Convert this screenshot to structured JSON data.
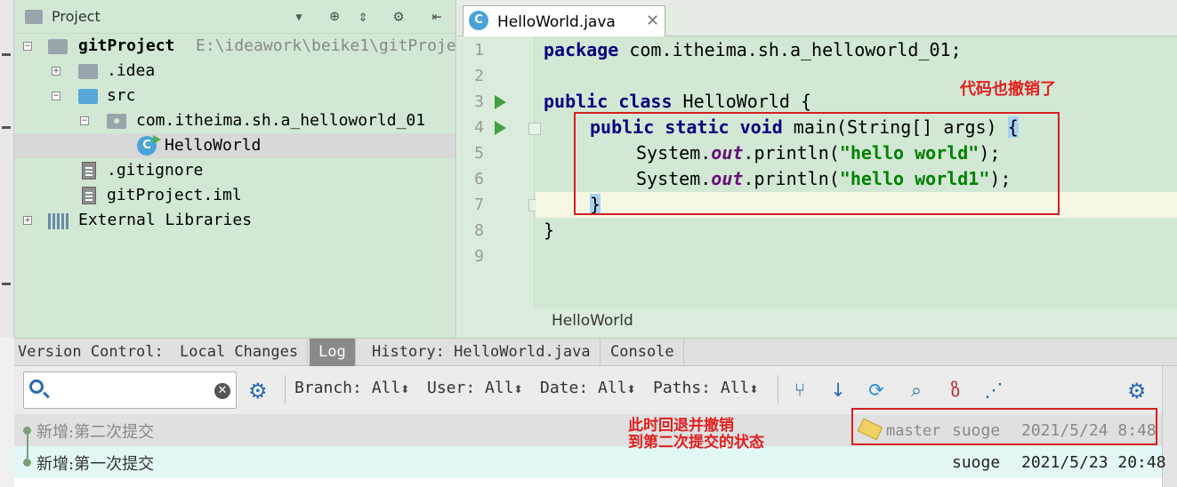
{
  "project_panel": {
    "title": "Project",
    "tree": [
      {
        "label": "gitProject",
        "path": "E:\\ideawork\\beike1\\gitProje"
      },
      {
        "label": ".idea"
      },
      {
        "label": "src"
      },
      {
        "label": "com.itheima.sh.a_helloworld_01"
      },
      {
        "label": "HelloWorld"
      },
      {
        "label": ".gitignore"
      },
      {
        "label": "gitProject.iml"
      },
      {
        "label": "External Libraries"
      }
    ]
  },
  "editor": {
    "tab_label": "HelloWorld.java",
    "line_numbers": [
      "1",
      "2",
      "3",
      "4",
      "5",
      "6",
      "7",
      "8",
      "9"
    ],
    "code": {
      "l1_kw": "package",
      "l1_rest": " com.itheima.sh.a_helloworld_01;",
      "l3_kw": "public class",
      "l3_rest": " HelloWorld {",
      "l4_kw": "public static void",
      "l4_rest": " main(String[] args) ",
      "l4_brace": "{",
      "l5_pre": "System.",
      "l5_field": "out",
      "l5_mid": ".println(",
      "l5_str": "\"hello world\"",
      "l5_end": ");",
      "l6_pre": "System.",
      "l6_field": "out",
      "l6_mid": ".println(",
      "l6_str": "\"hello world1\"",
      "l6_end": ");",
      "l7_brace": "}",
      "l8": "}"
    },
    "breadcrumb": "HelloWorld",
    "annotation": "代码也撤销了"
  },
  "version_control": {
    "label": "Version Control:",
    "tabs": [
      "Local Changes",
      "Log",
      "History: HelloWorld.java",
      "Console"
    ],
    "active_tab": "Log",
    "filters": [
      {
        "name": "Branch:",
        "value": "All"
      },
      {
        "name": "User:",
        "value": "All"
      },
      {
        "name": "Date:",
        "value": "All"
      },
      {
        "name": "Paths:",
        "value": "All"
      }
    ],
    "commits": [
      {
        "message": "新增:第二次提交",
        "branch": "master",
        "author": "suoge",
        "date": "2021/5/24 8:48"
      },
      {
        "message": "新增:第一次提交",
        "author": "suoge",
        "date": "2021/5/23 20:48"
      }
    ],
    "annotation_line1": "此时回退并撤销",
    "annotation_line2": "到第二次提交的状态"
  }
}
